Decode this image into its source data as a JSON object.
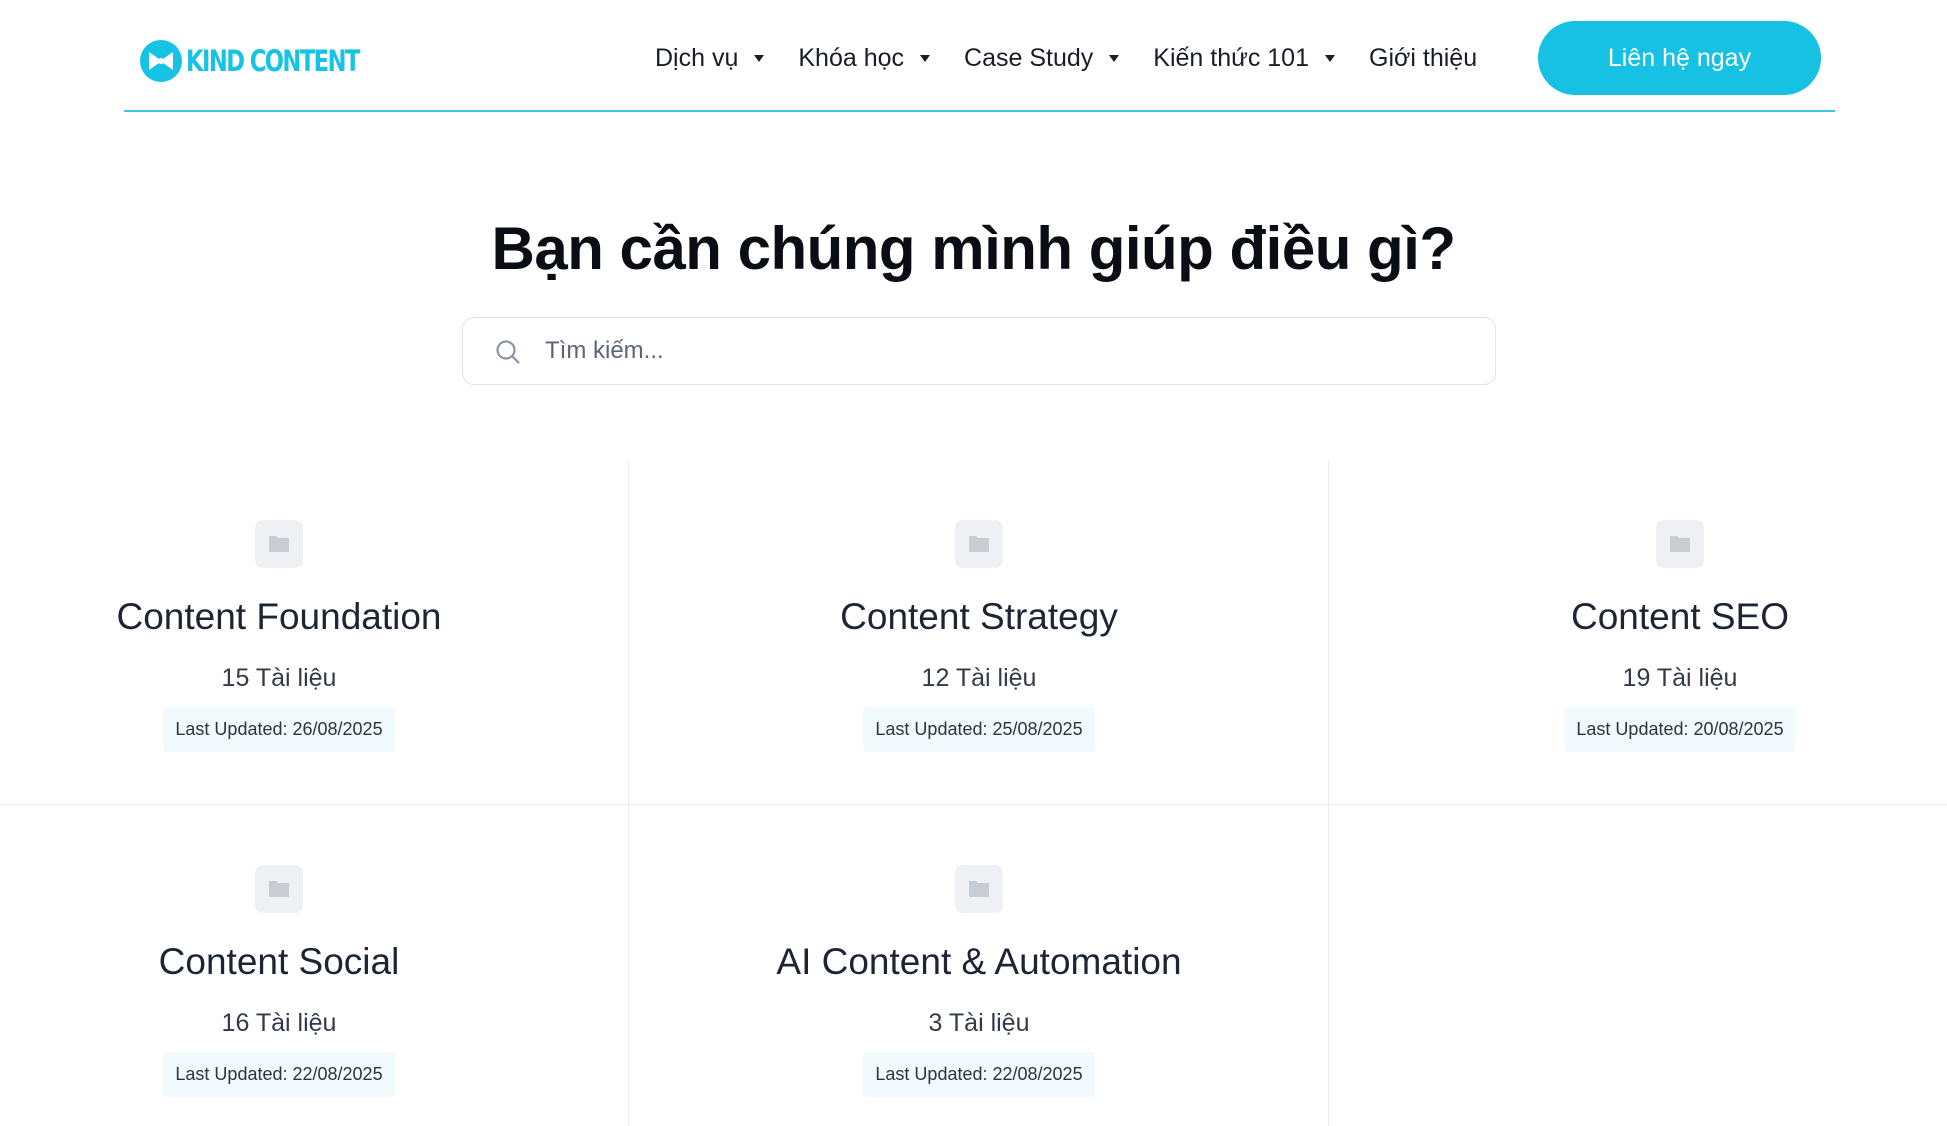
{
  "brand": {
    "name": "KIND CONTENT"
  },
  "nav": {
    "items": [
      {
        "label": "Dịch vụ",
        "has_dropdown": true
      },
      {
        "label": "Khóa học",
        "has_dropdown": true
      },
      {
        "label": "Case Study",
        "has_dropdown": true
      },
      {
        "label": "Kiến thức 101",
        "has_dropdown": true
      },
      {
        "label": "Giới thiệu",
        "has_dropdown": false
      }
    ],
    "cta_label": "Liên hệ ngay"
  },
  "hero": {
    "title": "Bạn cần chúng mình giúp điều gì?",
    "search_placeholder": "Tìm kiếm..."
  },
  "categories": [
    {
      "title": "Content Foundation",
      "count": "15 Tài liệu",
      "updated": "Last Updated: 26/08/2025"
    },
    {
      "title": "Content Strategy",
      "count": "12 Tài liệu",
      "updated": "Last Updated: 25/08/2025"
    },
    {
      "title": "Content SEO",
      "count": "19 Tài liệu",
      "updated": "Last Updated: 20/08/2025"
    },
    {
      "title": "Content Social",
      "count": "16 Tài liệu",
      "updated": "Last Updated: 22/08/2025"
    },
    {
      "title": "AI Content & Automation",
      "count": "3 Tài liệu",
      "updated": "Last Updated: 22/08/2025"
    }
  ],
  "colors": {
    "accent": "#16c1e3",
    "divider": "#40c4e3"
  },
  "icons": {
    "category": "folder-icon",
    "search": "search-icon",
    "dropdown": "caret-down-icon"
  }
}
